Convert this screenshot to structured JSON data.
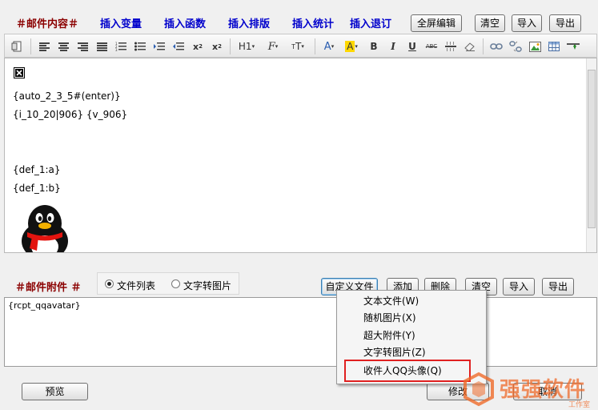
{
  "content_section": {
    "title": "＃邮件内容＃",
    "menu": [
      "插入变量",
      "插入函数",
      "插入排版",
      "插入统计",
      "插入退订"
    ],
    "buttons": {
      "fullscreen": "全屏编辑",
      "clear": "清空",
      "import": "导入",
      "export": "导出"
    }
  },
  "toolbar": {
    "heading": "H1",
    "font": "F",
    "size": "T",
    "bold": "B",
    "italic": "I",
    "underline": "U",
    "strike": "ABC"
  },
  "editor": {
    "lines": [
      "{auto_2_3_5#(enter)}",
      "{i_10_20|906} {v_906}",
      "{def_1:a}",
      "{def_1:b}"
    ]
  },
  "attachments": {
    "title": "＃邮件附件 ＃",
    "radios": [
      {
        "label": "文件列表",
        "checked": true
      },
      {
        "label": "文字转图片",
        "checked": false
      }
    ],
    "buttons": {
      "custom_file": "自定义文件",
      "add": "添加",
      "delete": "删除",
      "clear": "清空",
      "import": "导入",
      "export": "导出"
    },
    "content": "{rcpt_qqavatar}"
  },
  "context_menu": {
    "items": [
      "文本文件(W)",
      "随机图片(X)",
      "超大附件(Y)",
      "文字转图片(Z)",
      "收件人QQ头像(Q)"
    ]
  },
  "footer": {
    "preview": "预览",
    "modify": "修改",
    "cancel": "取消"
  },
  "watermark": {
    "text": "强强软件",
    "sub": "工作室"
  },
  "colors": {
    "section_title": "#8b0000",
    "menu_link": "#0000cc",
    "highlight": "#e02020",
    "watermark": "#ef6b2b"
  }
}
